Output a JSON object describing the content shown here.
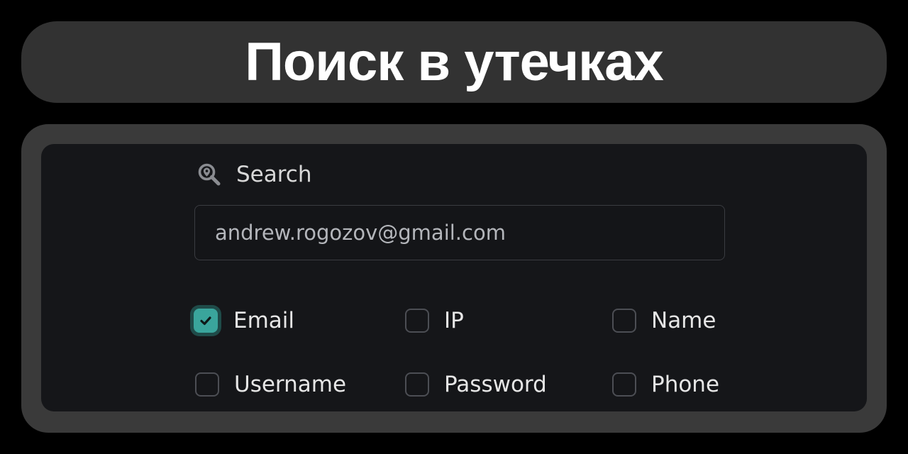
{
  "title": "Поиск в утечках",
  "search": {
    "label": "Search",
    "value": "andrew.rogozov@gmail.com",
    "icon": "search-location-icon"
  },
  "options": [
    {
      "label": "Email",
      "checked": true
    },
    {
      "label": "IP",
      "checked": false
    },
    {
      "label": "Name",
      "checked": false
    },
    {
      "label": "Username",
      "checked": false
    },
    {
      "label": "Password",
      "checked": false
    },
    {
      "label": "Phone",
      "checked": false
    }
  ],
  "colors": {
    "accent": "#3aa59c",
    "background": "#000000",
    "panel": "#151619",
    "title_bar": "#323232"
  }
}
